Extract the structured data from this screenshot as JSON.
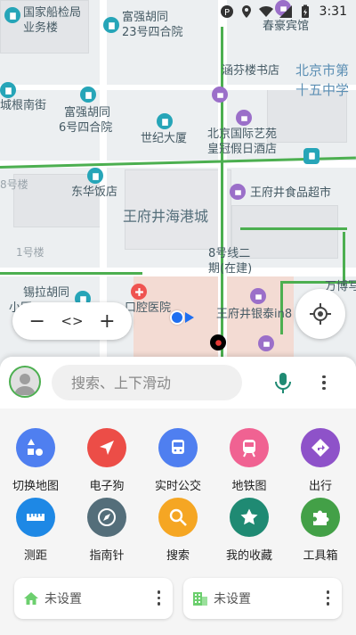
{
  "status_bar": {
    "time": "3:31"
  },
  "map": {
    "labels": {
      "l1": "国家船检局",
      "l2": "业务楼",
      "l3": "富强胡同",
      "l4": "23号四合院",
      "l5": "春豪宾馆",
      "l6": "涵芬楼书店",
      "l7": "北京市第",
      "l8": "十五中学",
      "l9": "城根南街",
      "l10": "富强胡同",
      "l11": "6号四合院",
      "l12": "世纪大厦",
      "l13": "北京国际艺苑",
      "l14": "皇冠假日酒店",
      "l15": "8号楼",
      "l16": "东华饭店",
      "l17": "王府井食品超市",
      "l18": "王府井海港城",
      "l19": "1号楼",
      "l20": "8号线二",
      "l21": "期(在建)",
      "l22": "万博写",
      "l23": "锡拉胡同",
      "l24": "小区",
      "l25": "口腔医院",
      "l26": "王府井银泰in8",
      "l27": "锡拉胡同小区"
    }
  },
  "map_controls": {
    "zoom_out": "−",
    "pan": "<>",
    "zoom_in": "+",
    "locate_icon": "my-location-icon"
  },
  "search": {
    "placeholder": "搜索、上下滑动",
    "mic_icon": "microphone-icon",
    "more_icon": "more-vertical-icon"
  },
  "tools": [
    {
      "label": "切换地图",
      "icon": "shapes-icon",
      "color": "#4f7ff0"
    },
    {
      "label": "电子狗",
      "icon": "navigation-arrow-icon",
      "color": "#ec4d47"
    },
    {
      "label": "实时公交",
      "icon": "bus-icon",
      "color": "#4f7ff0"
    },
    {
      "label": "地铁图",
      "icon": "subway-icon",
      "color": "#f06292"
    },
    {
      "label": "出行",
      "icon": "directions-icon",
      "color": "#8e52c9"
    },
    {
      "label": "测距",
      "icon": "ruler-icon",
      "color": "#1e88e5"
    },
    {
      "label": "指南针",
      "icon": "compass-icon",
      "color": "#546e7a"
    },
    {
      "label": "搜索",
      "icon": "search-icon",
      "color": "#f5a623"
    },
    {
      "label": "我的收藏",
      "icon": "star-icon",
      "color": "#1f8a73"
    },
    {
      "label": "工具箱",
      "icon": "puzzle-icon",
      "color": "#43a047"
    }
  ],
  "shortcuts": {
    "home": {
      "label": "未设置",
      "icon": "home-icon",
      "color": "#6ccf6e"
    },
    "work": {
      "label": "未设置",
      "icon": "building-icon",
      "color": "#6ccf6e"
    }
  }
}
